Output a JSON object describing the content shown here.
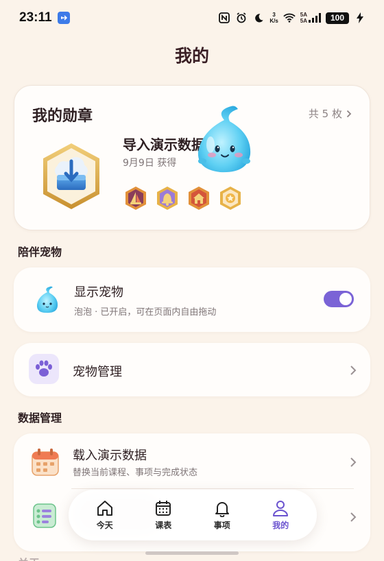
{
  "status_bar": {
    "time": "23:11",
    "net_speed_value": "3",
    "net_speed_unit": "K/s",
    "sim1": "5A",
    "sim2": "5A",
    "battery": "100"
  },
  "page": {
    "title": "我的"
  },
  "badges": {
    "title": "我的勋章",
    "count_label": "共 5 枚",
    "latest_name": "导入演示数据",
    "latest_date": "9月9日 获得",
    "mini_badge_icons": [
      "sail-badge-icon",
      "bell-badge-icon",
      "house-badge-icon",
      "star-badge-icon"
    ]
  },
  "pet_section": {
    "label": "陪伴宠物",
    "show_pet": {
      "title": "显示宠物",
      "subtitle": "泡泡 · 已开启，可在页面内自由拖动",
      "enabled": true
    },
    "manage": {
      "title": "宠物管理"
    }
  },
  "data_section": {
    "label": "数据管理",
    "load_demo": {
      "title": "载入演示数据",
      "subtitle": "替换当前课程、事项与完成状态"
    }
  },
  "about_label": "关于",
  "tabs": [
    {
      "label": "今天",
      "icon": "home-icon",
      "active": false
    },
    {
      "label": "课表",
      "icon": "calendar-icon",
      "active": false
    },
    {
      "label": "事项",
      "icon": "bell-icon",
      "active": false
    },
    {
      "label": "我的",
      "icon": "person-icon",
      "active": true
    }
  ],
  "colors": {
    "background": "#fbf3ea",
    "accent": "#6a52cf",
    "toggle_on": "#7a63d6",
    "card": "#fffdfb"
  }
}
